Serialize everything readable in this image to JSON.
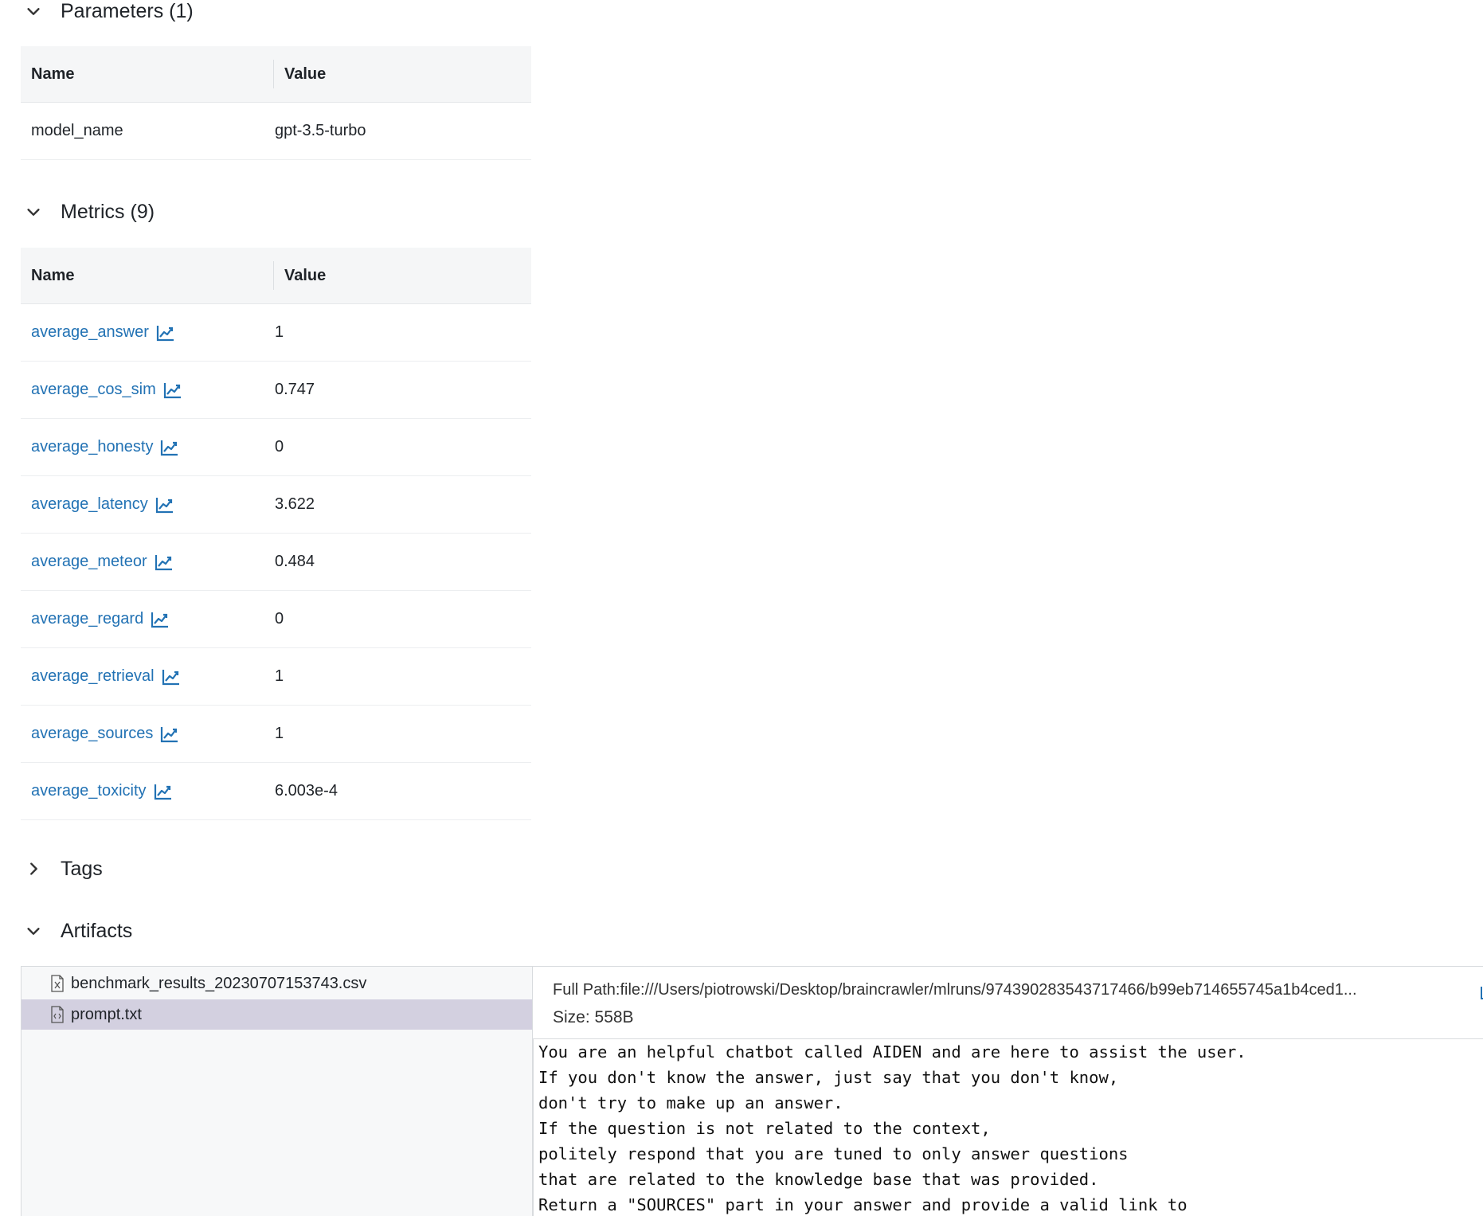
{
  "parameters": {
    "title": "Parameters (1)",
    "col_name": "Name",
    "col_value": "Value",
    "rows": [
      {
        "name": "model_name",
        "value": "gpt-3.5-turbo"
      }
    ]
  },
  "metrics": {
    "title": "Metrics (9)",
    "col_name": "Name",
    "col_value": "Value",
    "rows": [
      {
        "name": "average_answer",
        "value": "1"
      },
      {
        "name": "average_cos_sim",
        "value": "0.747"
      },
      {
        "name": "average_honesty",
        "value": "0"
      },
      {
        "name": "average_latency",
        "value": "3.622"
      },
      {
        "name": "average_meteor",
        "value": "0.484"
      },
      {
        "name": "average_regard",
        "value": "0"
      },
      {
        "name": "average_retrieval",
        "value": "1"
      },
      {
        "name": "average_sources",
        "value": "1"
      },
      {
        "name": "average_toxicity",
        "value": "6.003e-4"
      }
    ]
  },
  "tags": {
    "title": "Tags"
  },
  "artifacts": {
    "title": "Artifacts",
    "files": [
      {
        "name": "benchmark_results_20230707153743.csv",
        "icon": "spreadsheet-file-icon",
        "selected": false
      },
      {
        "name": "prompt.txt",
        "icon": "code-file-icon",
        "selected": true
      }
    ],
    "full_path": "Full Path:file:///Users/piotrowski/Desktop/braincrawler/mlruns/974390283543717466/b99eb714655745a1b4ced1...",
    "size": "Size: 558B",
    "preview_lines": [
      "You are an helpful chatbot called AIDEN and are here to assist the user.",
      "If you don't know the answer, just say that you don't know,",
      "don't try to make up an answer.",
      "If the question is not related to the context,",
      "politely respond that you are tuned to only answer questions",
      "that are related to the knowledge base that was provided.",
      "Return a \"SOURCES\" part in your answer and provide a valid link to"
    ]
  },
  "colors": {
    "link": "#2272b4",
    "selected_bg": "#d3d0e0",
    "header_bg": "#f5f6f7"
  }
}
